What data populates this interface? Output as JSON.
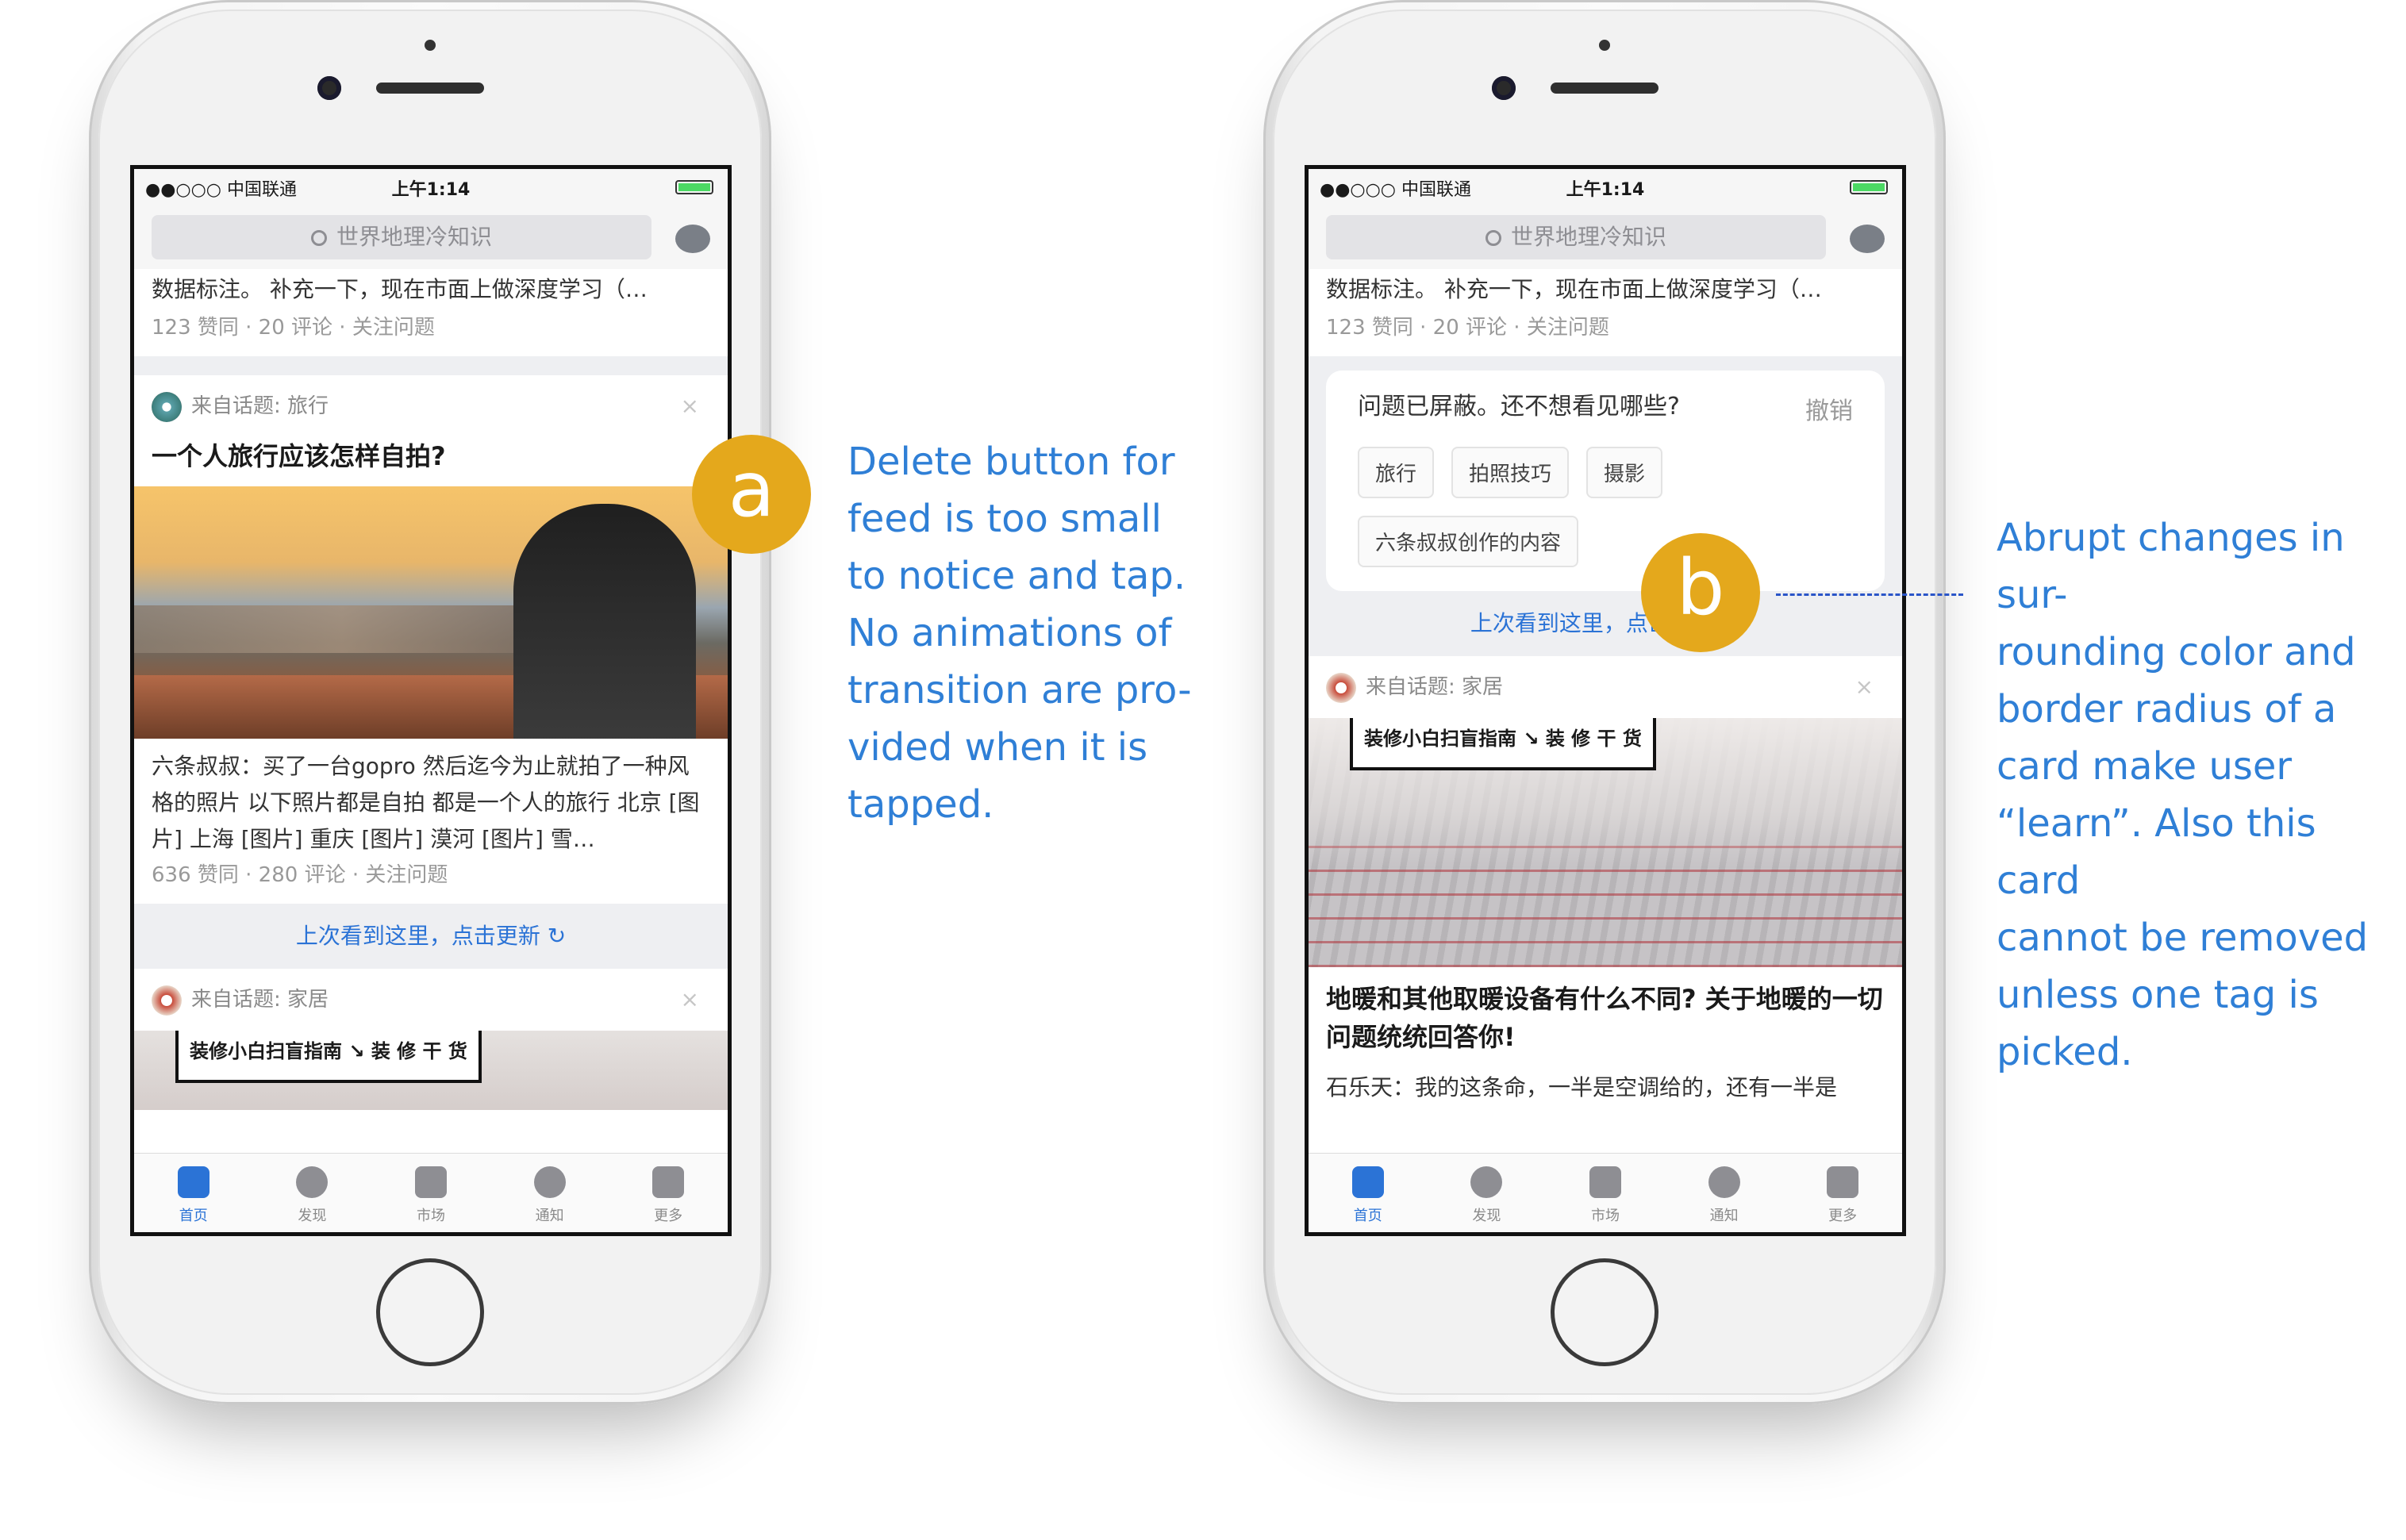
{
  "status": {
    "carrier": "●●○○○ 中国联通",
    "time": "上午1:14"
  },
  "search": {
    "placeholder": "世界地理冷知识"
  },
  "top_card": {
    "excerpt": "数据标注。 补充一下，现在市面上做深度学习（…",
    "meta": "123 赞同 · 20 评论 · 关注问题"
  },
  "left": {
    "card1": {
      "topic": "来自话题: 旅行",
      "close": "×",
      "title": "一个人旅行应该怎样自拍?",
      "answer": "六条叔叔：买了一台gopro 然后迄今为止就拍了一种风格的照片 以下照片都是自拍 都是一个人的旅行 北京 [图片] 上海 [图片] 重庆 [图片] 漠河 [图片] 雪…",
      "meta": "636 赞同 · 280 评论 · 关注问题"
    },
    "refresh": "上次看到这里，点击更新 ↻",
    "card2": {
      "topic": "来自话题: 家居",
      "close": "×",
      "thumb_label": "装修小白扫盲指南 ↘ 装 修 干 货"
    }
  },
  "right": {
    "block": {
      "title": "问题已屏蔽。还不想看见哪些?",
      "undo": "撤销",
      "tags": [
        "旅行",
        "拍照技巧",
        "摄影",
        "六条叔叔创作的内容"
      ]
    },
    "refresh": "上次看到这里，点击更新 ↻",
    "card": {
      "topic": "来自话题: 家居",
      "close": "×",
      "image_label": "装修小白扫盲指南 ↘ 装 修 干 货",
      "title": "地暖和其他取暖设备有什么不同? 关于地暖的一切问题统统回答你!",
      "answer": "石乐天：我的这条命，一半是空调给的，还有一半是"
    }
  },
  "tabs": [
    {
      "label": "首页",
      "icon": "home-feed-icon",
      "active": true
    },
    {
      "label": "发现",
      "icon": "compass-icon",
      "active": false
    },
    {
      "label": "市场",
      "icon": "store-icon",
      "active": false
    },
    {
      "label": "通知",
      "icon": "bell-icon",
      "active": false
    },
    {
      "label": "更多",
      "icon": "menu-icon",
      "active": false
    }
  ],
  "annotations": {
    "a": {
      "letter": "a",
      "lines": [
        "Delete button for",
        "feed is too small",
        "to notice and tap.",
        "No animations of",
        "transition are pro-",
        "vided when it is",
        "tapped."
      ]
    },
    "b": {
      "letter": "b",
      "lines": [
        "Abrupt changes in sur-",
        "rounding color and",
        "border radius of a",
        "card make user",
        "“learn”. Also this card",
        "cannot be removed",
        "unless one tag is",
        "picked."
      ]
    }
  },
  "colors": {
    "accent": "#2b73d6",
    "badge": "#e4a81c",
    "note_text": "#2f7fd6"
  }
}
